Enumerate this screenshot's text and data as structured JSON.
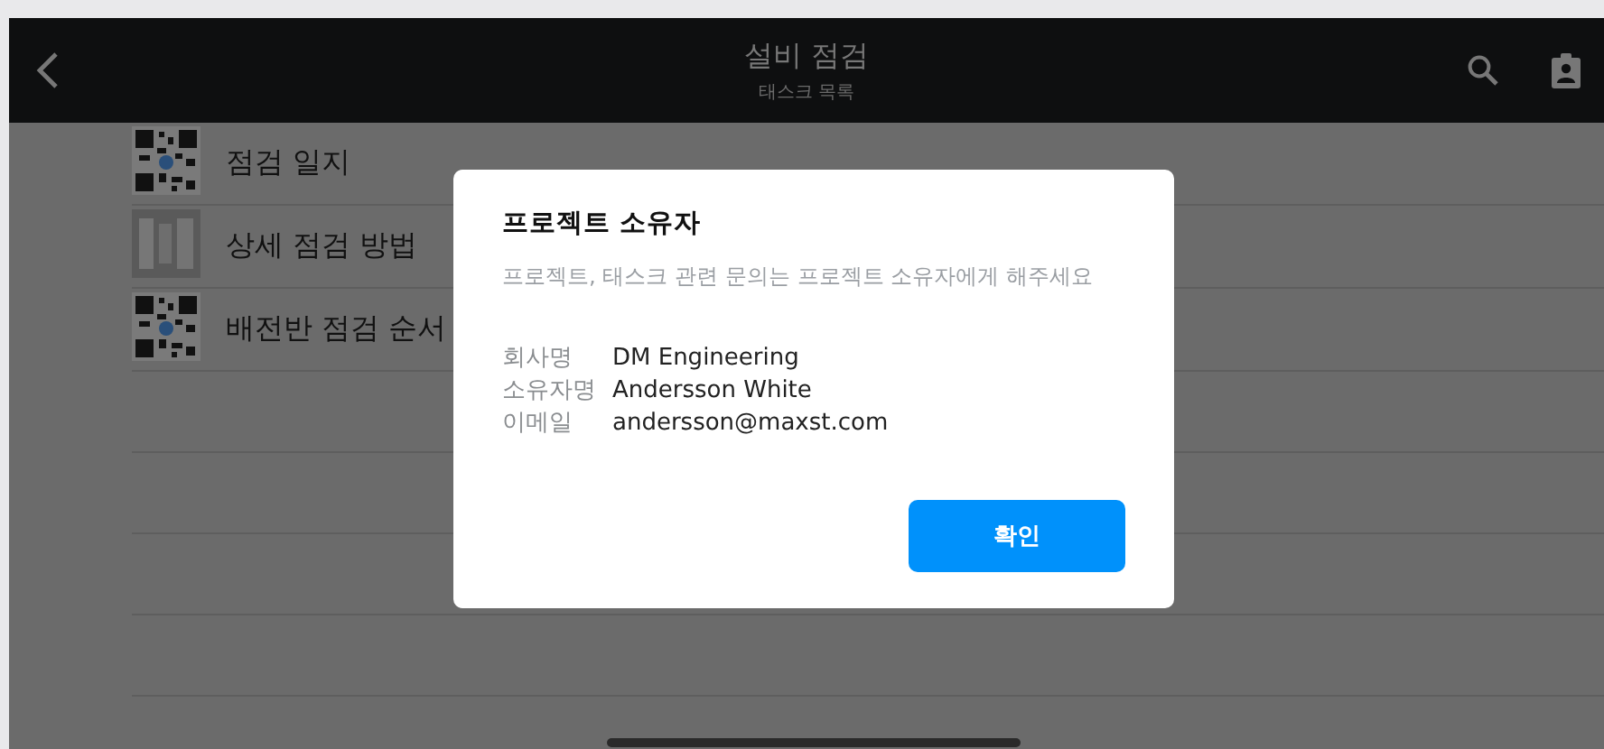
{
  "header": {
    "title": "설비 점검",
    "subtitle": "태스크 목록"
  },
  "tasks": [
    {
      "label": "점검 일지",
      "kind": "qr"
    },
    {
      "label": "상세 점검 방법",
      "kind": "photo"
    },
    {
      "label": "배전반 점검 순서",
      "kind": "qr"
    }
  ],
  "dialog": {
    "title": "프로젝트 소유자",
    "message": "프로젝트, 태스크 관련 문의는 프로젝트 소유자에게 해주세요",
    "fields": [
      {
        "label": "회사명",
        "value": "DM Engineering"
      },
      {
        "label": "소유자명",
        "value": "Andersson White"
      },
      {
        "label": "이메일",
        "value": "andersson@maxst.com"
      }
    ],
    "button": "확인"
  }
}
